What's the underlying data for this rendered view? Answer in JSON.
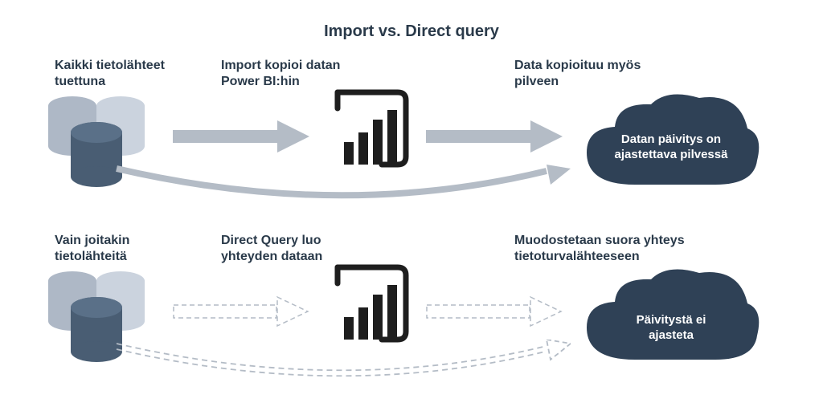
{
  "title": "Import vs. Direct query",
  "import_row": {
    "src_label": "Kaikki tietolähteet tuettuna",
    "arrow1_label": "Import kopioi datan Power BI:hin",
    "dest_label": "Data kopioituu myös pilveen",
    "cloud_text": "Datan päivitys on ajastettava pilvessä"
  },
  "dq_row": {
    "src_label": "Vain joitakin tietolähteitä",
    "arrow1_label": "Direct Query luo yhteyden dataan",
    "dest_label": "Muodostetaan suora yhteys tietoturvalähteeseen",
    "cloud_text": "Päivitystä ei ajasteta"
  },
  "colors": {
    "cyl1": "#AEB8C6",
    "cyl2": "#CBD3DE",
    "cyl3": "#495D73",
    "cloud": "#2F4156",
    "arrow_solid": "#B4BCC6",
    "arrow_outline": "#B4BCC6",
    "pbi": "#1E1E1E"
  }
}
